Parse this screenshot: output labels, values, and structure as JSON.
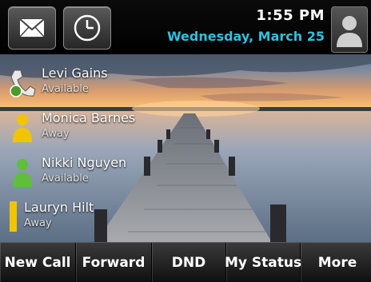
{
  "header": {
    "time": "1:55 PM",
    "date": "Wednesday, March 25",
    "messages_icon": "envelope-icon",
    "clock_icon": "clock-icon",
    "profile_icon": "person-silhouette-icon"
  },
  "contacts": [
    {
      "name": "Levi Gains",
      "status": "Available",
      "icon": "phone-handset-icon"
    },
    {
      "name": "Monica Barnes",
      "status": "Away",
      "icon": "person-icon-yellow"
    },
    {
      "name": "Nikki Nguyen",
      "status": "Available",
      "icon": "person-icon-green"
    },
    {
      "name": "Lauryn Hilt",
      "status": "Away",
      "icon": "status-bar-yellow"
    }
  ],
  "softkeys": [
    "New Call",
    "Forward",
    "DND",
    "My Status",
    "More"
  ],
  "colors": {
    "date": "#2cc2e0",
    "available": "#5fbf3a",
    "away": "#f2c400"
  }
}
